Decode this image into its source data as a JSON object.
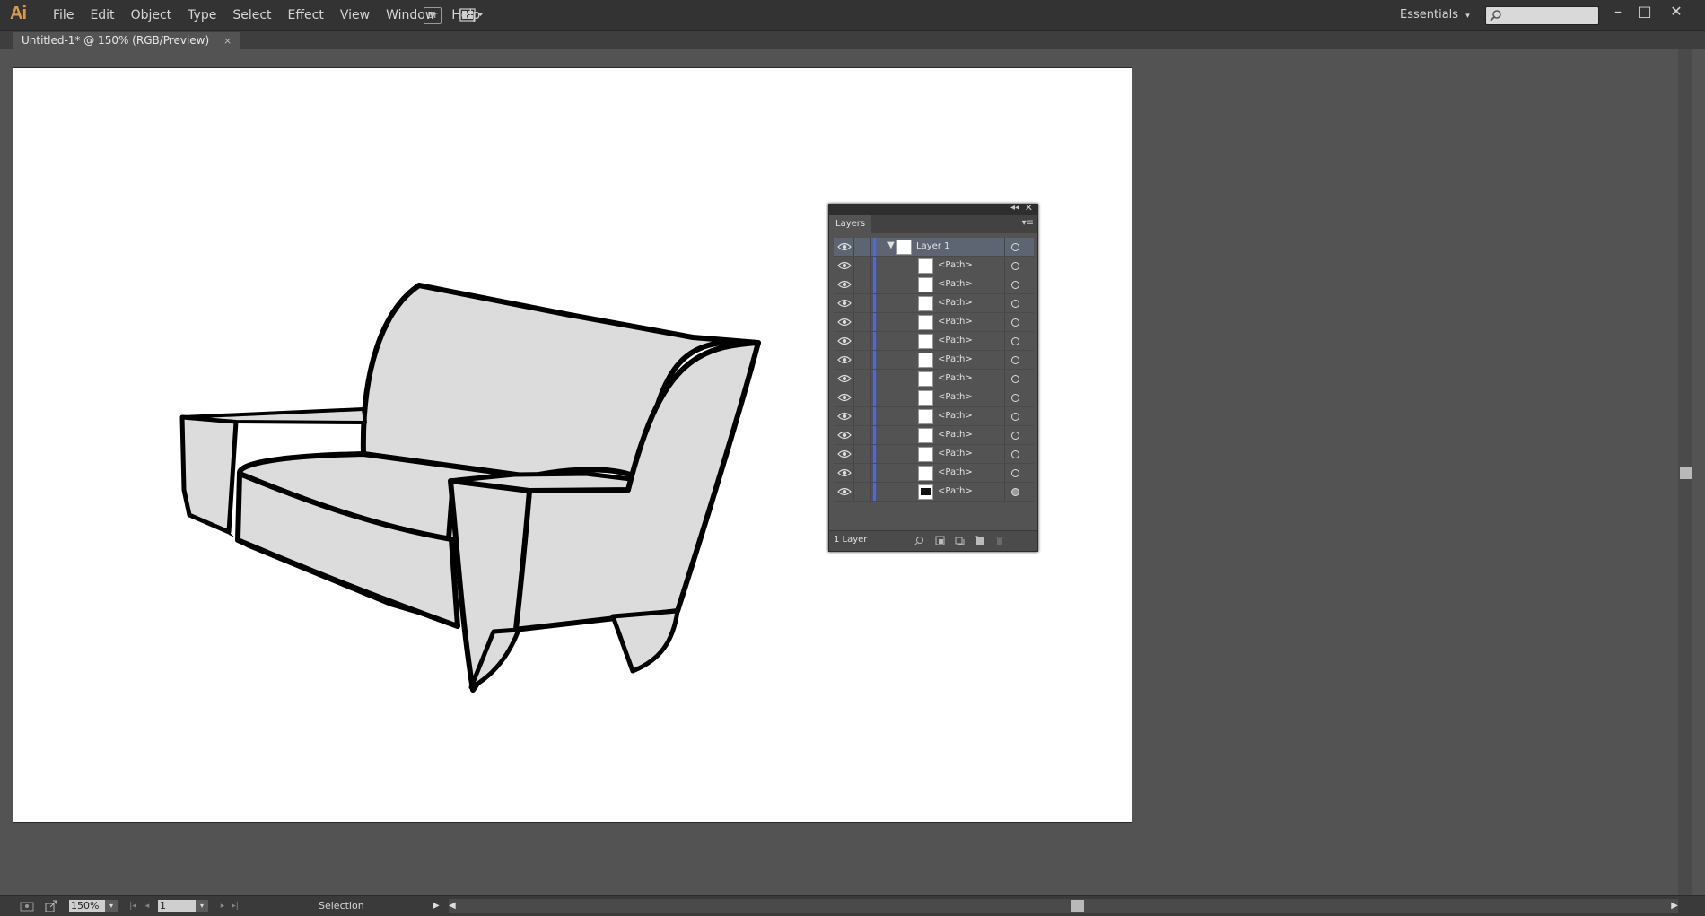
{
  "app": {
    "logo": "Ai"
  },
  "menu": [
    "File",
    "Edit",
    "Object",
    "Type",
    "Select",
    "Effect",
    "View",
    "Window",
    "Help"
  ],
  "toolbar": {
    "bridge_label": "Br"
  },
  "workspace": {
    "label": "Essentials",
    "arrow": "▾"
  },
  "search": {
    "placeholder": ""
  },
  "window_controls": {
    "minimize": "–",
    "maximize": "□",
    "close": "✕"
  },
  "document_tab": {
    "title": "Untitled-1* @ 150% (RGB/Preview)",
    "close": "×"
  },
  "layers_panel": {
    "tab": "Layers",
    "collapse": "◂◂",
    "close": "✕",
    "menu": "▾≡",
    "layer": {
      "name": "Layer 1",
      "twirl": "▼"
    },
    "items": [
      "<Path>",
      "<Path>",
      "<Path>",
      "<Path>",
      "<Path>",
      "<Path>",
      "<Path>",
      "<Path>",
      "<Path>",
      "<Path>",
      "<Path>",
      "<Path>",
      "<Path>"
    ],
    "footer_count": "1 Layer"
  },
  "status": {
    "zoom": "150%",
    "zoom_arrow": "▾",
    "page": "1",
    "page_arrow": "▾",
    "tool": "Selection",
    "tool_arrow": "▶",
    "first": "|◂",
    "prev": "◂",
    "next": "▸",
    "last": "▸|",
    "scroll_left": "◀",
    "scroll_right": "▶"
  },
  "colors": {
    "accent": "#d69a4e",
    "layer_color": "#4f6ad6",
    "canvas_bg": "#535353",
    "sofa_fill": "#dcdcdc"
  }
}
